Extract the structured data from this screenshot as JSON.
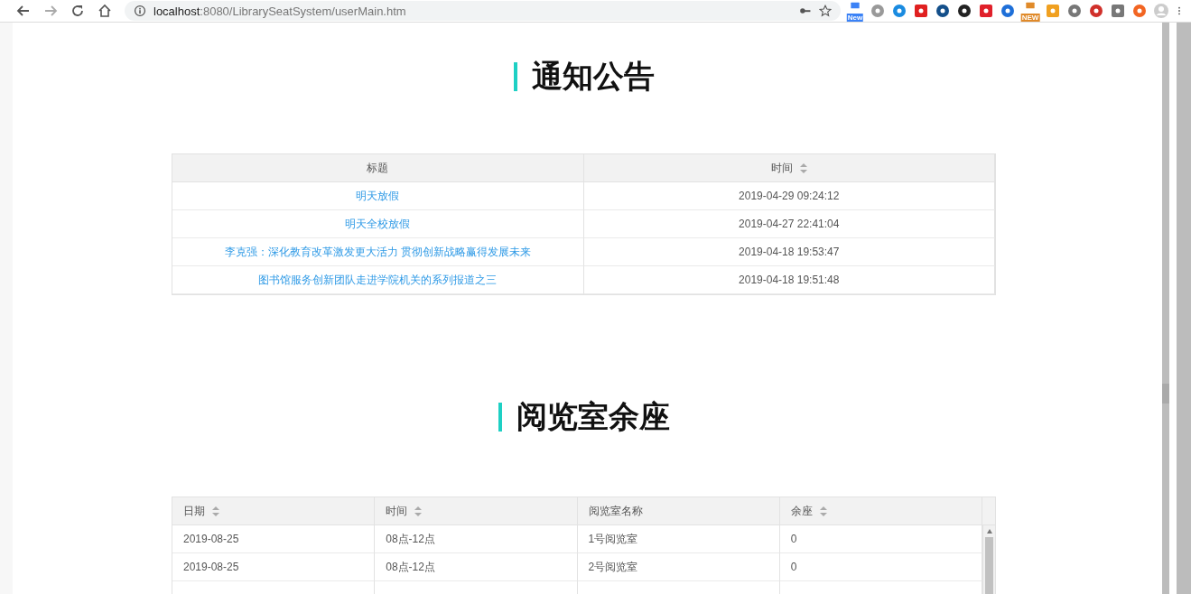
{
  "browser": {
    "url_host": "localhost",
    "url_path": ":8080/LibrarySeatSystem/userMain.htm",
    "extension_badges": [
      "New",
      "NEW"
    ]
  },
  "notices": {
    "title": "通知公告",
    "columns": [
      {
        "label": "标题",
        "sortable": false
      },
      {
        "label": "时间",
        "sortable": true
      }
    ],
    "rows": [
      {
        "title": "明天放假",
        "time": "2019-04-29 09:24:12"
      },
      {
        "title": "明天全校放假",
        "time": "2019-04-27 22:41:04"
      },
      {
        "title": "李克强：深化教育改革激发更大活力 贯彻创新战略赢得发展未来",
        "time": "2019-04-18 19:53:47"
      },
      {
        "title": "图书馆服务创新团队走进学院机关的系列报道之三",
        "time": "2019-04-18 19:51:48"
      }
    ]
  },
  "seats": {
    "title": "阅览室余座",
    "columns": [
      {
        "label": "日期",
        "sortable": true
      },
      {
        "label": "时间",
        "sortable": true
      },
      {
        "label": "阅览室名称",
        "sortable": false
      },
      {
        "label": "余座",
        "sortable": true
      }
    ],
    "rows": [
      [
        "2019-08-25",
        "08点-12点",
        "1号阅览室",
        "0"
      ],
      [
        "2019-08-25",
        "08点-12点",
        "2号阅览室",
        "0"
      ]
    ]
  }
}
